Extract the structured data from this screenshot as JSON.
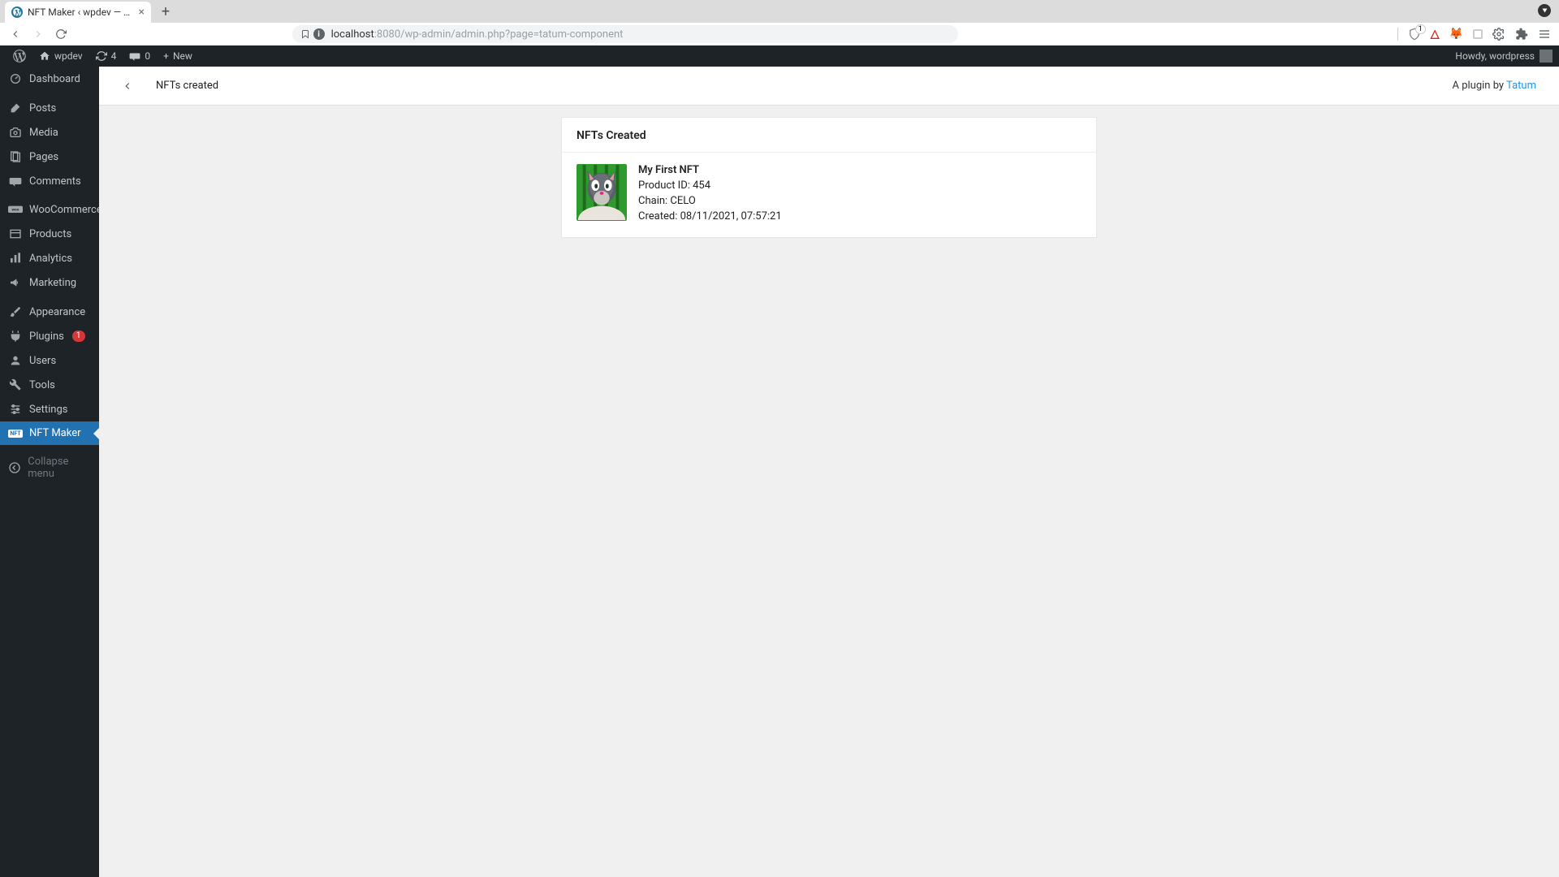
{
  "browser": {
    "tab_title": "NFT Maker ‹ wpdev — WordPre",
    "url_host": "localhost",
    "url_port_path": ":8080/wp-admin/admin.php?page=tatum-component",
    "brave_count": "1"
  },
  "adminbar": {
    "site_name": "wpdev",
    "updates": "4",
    "comments": "0",
    "new_label": "New",
    "howdy_prefix": "Howdy, ",
    "howdy_user": "wordpress"
  },
  "sidebar": {
    "items": [
      {
        "label": "Dashboard",
        "icon": "dashboard"
      },
      {
        "label": "Posts",
        "icon": "posts"
      },
      {
        "label": "Media",
        "icon": "media"
      },
      {
        "label": "Pages",
        "icon": "pages"
      },
      {
        "label": "Comments",
        "icon": "comments"
      },
      {
        "label": "WooCommerce",
        "icon": "woo"
      },
      {
        "label": "Products",
        "icon": "products"
      },
      {
        "label": "Analytics",
        "icon": "analytics"
      },
      {
        "label": "Marketing",
        "icon": "marketing"
      },
      {
        "label": "Appearance",
        "icon": "appearance"
      },
      {
        "label": "Plugins",
        "icon": "plugins",
        "badge": "1"
      },
      {
        "label": "Users",
        "icon": "users"
      },
      {
        "label": "Tools",
        "icon": "tools"
      },
      {
        "label": "Settings",
        "icon": "settings"
      },
      {
        "label": "NFT Maker",
        "icon": "nft",
        "active": true
      }
    ],
    "collapse_label": "Collapse menu"
  },
  "page": {
    "title": "NFTs created",
    "plugin_by_prefix": "A plugin by ",
    "plugin_by_link": "Tatum",
    "card_heading": "NFTs Created",
    "nft": {
      "name": "My First NFT",
      "product_id_label": "Product ID: ",
      "product_id": "454",
      "chain_label": "Chain: ",
      "chain": "CELO",
      "created_label": "Created: ",
      "created_at": "08/11/2021, 07:57:21"
    }
  }
}
